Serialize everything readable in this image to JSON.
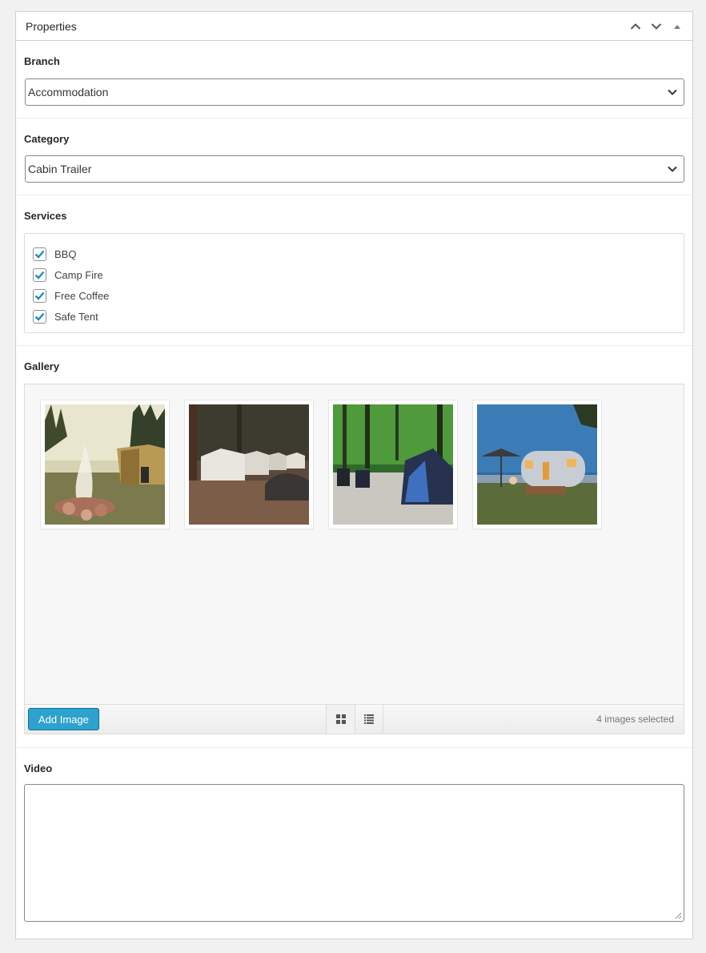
{
  "panel": {
    "title": "Properties"
  },
  "icons": {
    "move_up": "chevron-up-icon",
    "move_down": "chevron-down-icon",
    "toggle": "triangle-up-icon"
  },
  "branch": {
    "label": "Branch",
    "selected": "Accommodation"
  },
  "category": {
    "label": "Category",
    "selected": "Cabin Trailer"
  },
  "services": {
    "label": "Services",
    "items": [
      {
        "label": "BBQ",
        "checked": true
      },
      {
        "label": "Camp Fire",
        "checked": true
      },
      {
        "label": "Free Coffee",
        "checked": true
      },
      {
        "label": "Safe Tent",
        "checked": true
      }
    ]
  },
  "gallery": {
    "label": "Gallery",
    "images": [
      {
        "subject": "campfire-tent-photo"
      },
      {
        "subject": "cabin-tents-forest-photo"
      },
      {
        "subject": "camping-tent-woods-photo"
      },
      {
        "subject": "vintage-trailer-dusk-photo"
      }
    ],
    "add_button": "Add Image",
    "view": "grid",
    "count_text": "4 images selected"
  },
  "video": {
    "label": "Video",
    "value": ""
  },
  "colors": {
    "accent": "#2ea2cc",
    "checkbox_check": "#1e8cbe",
    "border": "#ccd0d4"
  }
}
